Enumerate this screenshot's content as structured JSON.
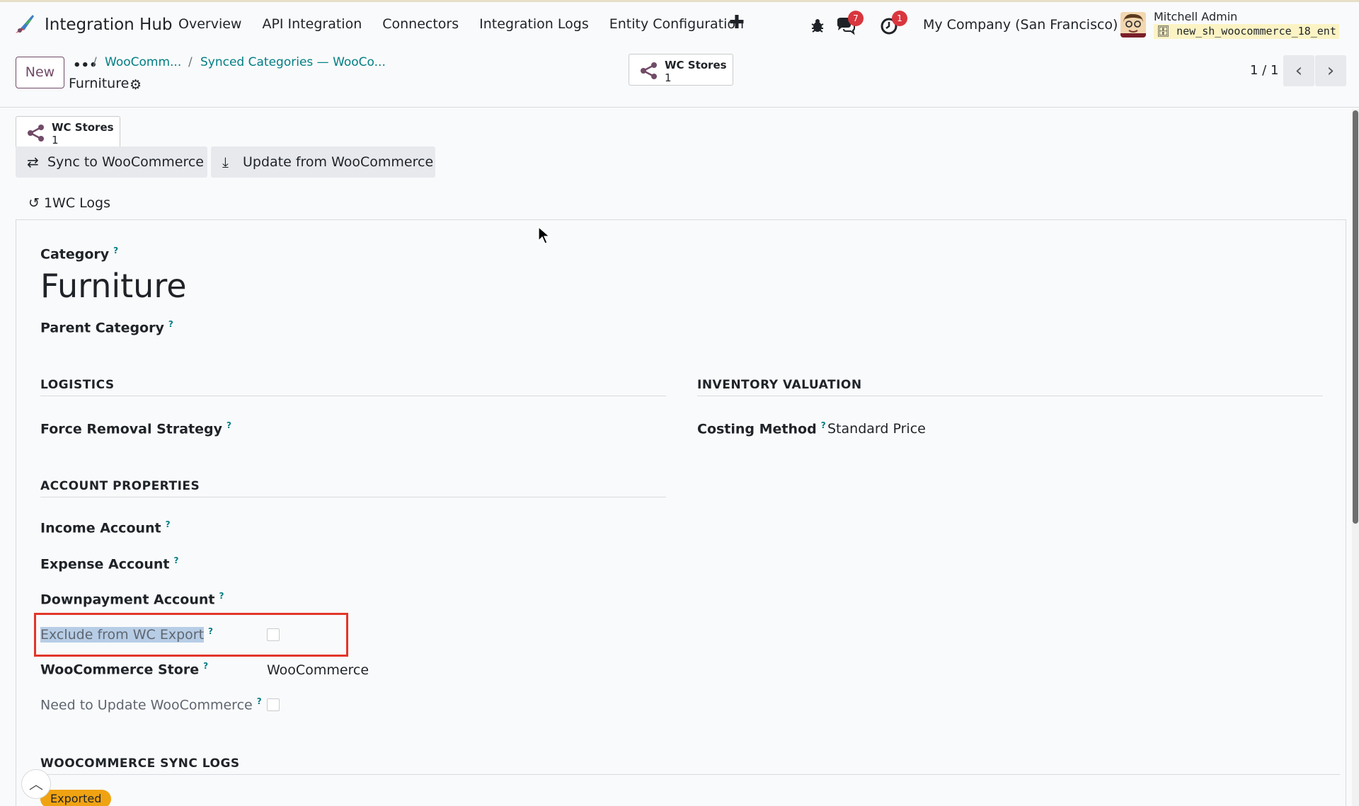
{
  "navbar": {
    "app_name": "Integration Hub",
    "menu": [
      "Overview",
      "API Integration",
      "Connectors",
      "Integration Logs",
      "Entity Configuration"
    ],
    "messages_count": "7",
    "activities_count": "1",
    "company": "My Company (San Francisco)",
    "user_name": "Mitchell Admin",
    "database": "new_sh_woocommerce_18_ent"
  },
  "control_panel": {
    "new_label": "New",
    "breadcrumb": [
      "WooComm...",
      "Synced Categories — WooCo..."
    ],
    "record_name": "Furniture",
    "stat_label": "WC Stores",
    "stat_value": "1",
    "pager": "1 / 1"
  },
  "actions": {
    "stat_label": "WC Stores",
    "stat_value": "1",
    "sync_label": "Sync to WooCommerce",
    "update_label": "Update from WooCommerce",
    "logs_label": "1WC Logs"
  },
  "form": {
    "category_label": "Category",
    "category_value": "Furniture",
    "parent_label": "Parent Category",
    "logistics_title": "LOGISTICS",
    "force_removal_label": "Force Removal Strategy",
    "inventory_title": "INVENTORY VALUATION",
    "costing_label": "Costing Method",
    "costing_value": "Standard Price",
    "account_title": "ACCOUNT PROPERTIES",
    "income_label": "Income Account",
    "expense_label": "Expense Account",
    "downpayment_label": "Downpayment Account",
    "exclude_label": "Exclude from WC Export",
    "store_label": "WooCommerce Store",
    "store_value": "WooCommerce",
    "need_update_label": "Need to Update WooCommerce",
    "sync_logs_title": "WOOCOMMERCE SYNC LOGS",
    "status_pill": "Exported"
  },
  "colors": {
    "accent": "#714b67",
    "link": "#017e84",
    "badge": "#d9363e",
    "highlight": "#e2362a",
    "pill": "#f0a312"
  }
}
